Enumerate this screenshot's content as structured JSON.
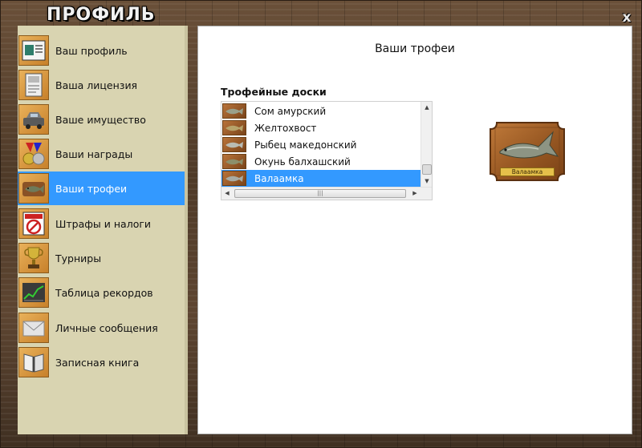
{
  "window": {
    "title": "ПРОФИЛЬ",
    "close_label": "x"
  },
  "sidebar": {
    "items": [
      {
        "label": "Ваш профиль",
        "icon": "profile-card-icon",
        "active": false
      },
      {
        "label": "Ваша лицензия",
        "icon": "license-document-icon",
        "active": false
      },
      {
        "label": "Ваше имущество",
        "icon": "car-icon",
        "active": false
      },
      {
        "label": "Ваши награды",
        "icon": "medals-icon",
        "active": false
      },
      {
        "label": "Ваши трофеи",
        "icon": "fish-trophy-icon",
        "active": true
      },
      {
        "label": "Штрафы и налоги",
        "icon": "fines-sign-icon",
        "active": false
      },
      {
        "label": "Турниры",
        "icon": "cup-icon",
        "active": false
      },
      {
        "label": "Таблица рекордов",
        "icon": "records-chart-icon",
        "active": false
      },
      {
        "label": "Личные сообщения",
        "icon": "envelope-icon",
        "active": false
      },
      {
        "label": "Записная книга",
        "icon": "notebook-icon",
        "active": false
      }
    ]
  },
  "content": {
    "title": "Ваши трофеи",
    "boards_label": "Трофейные доски",
    "boards": [
      {
        "label": "Сом амурский",
        "selected": false
      },
      {
        "label": "Желтохвост",
        "selected": false
      },
      {
        "label": "Рыбец македонский",
        "selected": false
      },
      {
        "label": "Окунь балхашский",
        "selected": false
      },
      {
        "label": "Валаамка",
        "selected": true
      }
    ],
    "preview": {
      "plaque_text": "Валаамка"
    }
  },
  "colors": {
    "accent": "#3399ff",
    "sidebar_bg": "#d9d4b1",
    "content_bg": "#ffffff"
  }
}
